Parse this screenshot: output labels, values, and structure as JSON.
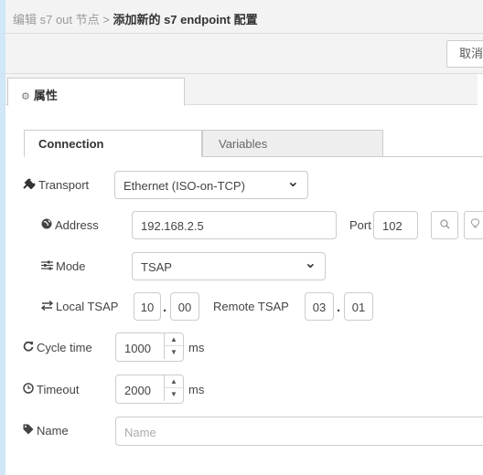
{
  "header": {
    "breadcrumb_prefix": "编辑 s7 out 节点 > ",
    "breadcrumb_current": "添加新的 s7 endpoint 配置",
    "cancel_label": "取消"
  },
  "main_tab": {
    "label": "属性"
  },
  "subtabs": {
    "connection": "Connection",
    "variables": "Variables"
  },
  "form": {
    "transport": {
      "label": "Transport",
      "value": "Ethernet (ISO-on-TCP)"
    },
    "address": {
      "label": "Address",
      "value": "192.168.2.5"
    },
    "port": {
      "label": "Port",
      "value": "102"
    },
    "mode": {
      "label": "Mode",
      "value": "TSAP"
    },
    "local_tsap": {
      "label": "Local TSAP",
      "value_a": "10",
      "value_b": "00"
    },
    "remote_tsap": {
      "label": "Remote TSAP",
      "value_a": "03",
      "value_b": "01"
    },
    "cycle_time": {
      "label": "Cycle time",
      "value": "1000",
      "unit": "ms"
    },
    "timeout": {
      "label": "Timeout",
      "value": "2000",
      "unit": "ms"
    },
    "name": {
      "label": "Name",
      "placeholder": "Name"
    }
  },
  "icons": {
    "settings": "gear-icon",
    "transport": "plug-icon",
    "address": "globe-icon",
    "mode": "sliders-icon",
    "tsap": "exchange-icon",
    "cycle_time": "refresh-icon",
    "timeout": "clock-icon",
    "name": "tag-icon",
    "search": "search-icon",
    "lightbulb": "lightbulb-icon"
  }
}
